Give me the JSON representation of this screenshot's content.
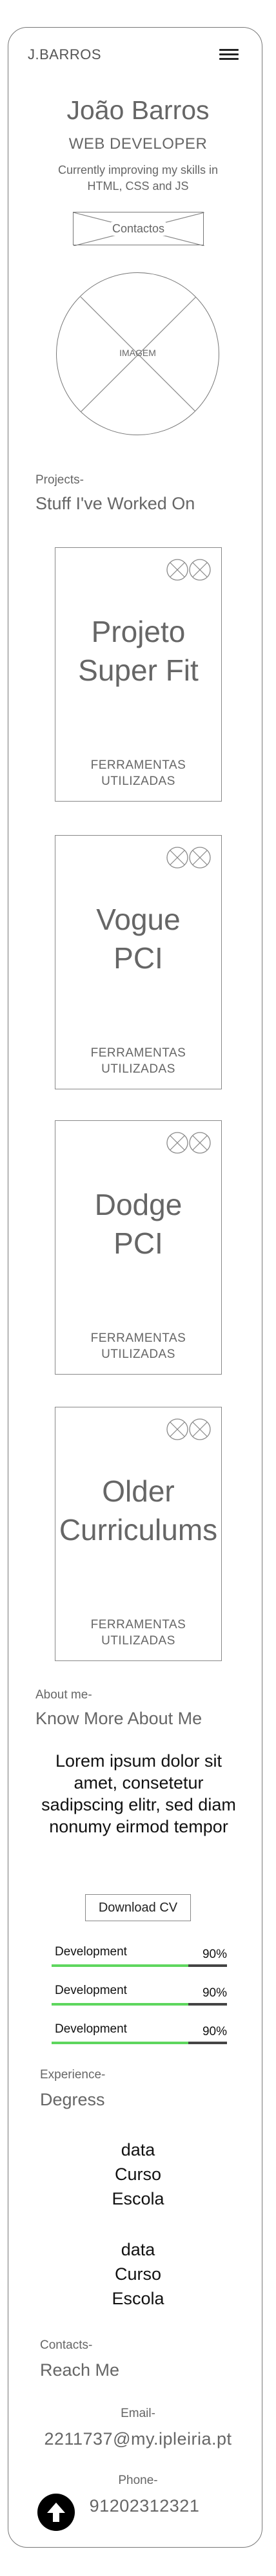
{
  "header": {
    "brand": "J.BARROS",
    "menu_icon": "hamburger-menu-icon"
  },
  "hero": {
    "name": "João Barros",
    "role": "WEB DEVELOPER",
    "tagline": "Currently improving my skills in HTML, CSS and JS",
    "contact_button": "Contactos",
    "portrait_placeholder": "IMAGEM"
  },
  "projects": {
    "label": "Projects-",
    "title": "Stuff I've Worked On",
    "cards": [
      {
        "title_line1": "Projeto",
        "title_line2": "Super Fit",
        "tools_line1": "FERRAMENTAS",
        "tools_line2": "UTILIZADAS"
      },
      {
        "title_line1": "Vogue",
        "title_line2": "PCI",
        "tools_line1": "FERRAMENTAS",
        "tools_line2": "UTILIZADAS"
      },
      {
        "title_line1": "Dodge",
        "title_line2": "PCI",
        "tools_line1": "FERRAMENTAS",
        "tools_line2": "UTILIZADAS"
      },
      {
        "title_line1": "Older",
        "title_line2": "Curriculums",
        "tools_line1": "FERRAMENTAS",
        "tools_line2": "UTILIZADAS"
      }
    ]
  },
  "about": {
    "label": "About me-",
    "title": "Know More About Me",
    "lorem": "Lorem ipsum dolor sit amet, consetetur sadipscing elitr, sed diam nonumy eirmod tempor",
    "cv_button": "Download CV",
    "skills": [
      {
        "name": "Development",
        "percent_label": "90%",
        "level": 0.78
      },
      {
        "name": "Development",
        "percent_label": "90%",
        "level": 0.78
      },
      {
        "name": "Development",
        "percent_label": "90%",
        "level": 0.78
      }
    ]
  },
  "experience": {
    "label": "Experience-",
    "title": "Degress",
    "entries": [
      {
        "date": "data",
        "course": "Curso",
        "school": "Escola"
      },
      {
        "date": "data",
        "course": "Curso",
        "school": "Escola"
      }
    ]
  },
  "contacts": {
    "label": "Contacts-",
    "title": "Reach Me",
    "email_label": "Email-",
    "email": "2211737@my.ipleiria.pt",
    "phone_label": "Phone-",
    "phone": "91202312321"
  },
  "colors": {
    "skill_bar": "#5ed65e",
    "track": "#444444",
    "outline": "#777777"
  }
}
